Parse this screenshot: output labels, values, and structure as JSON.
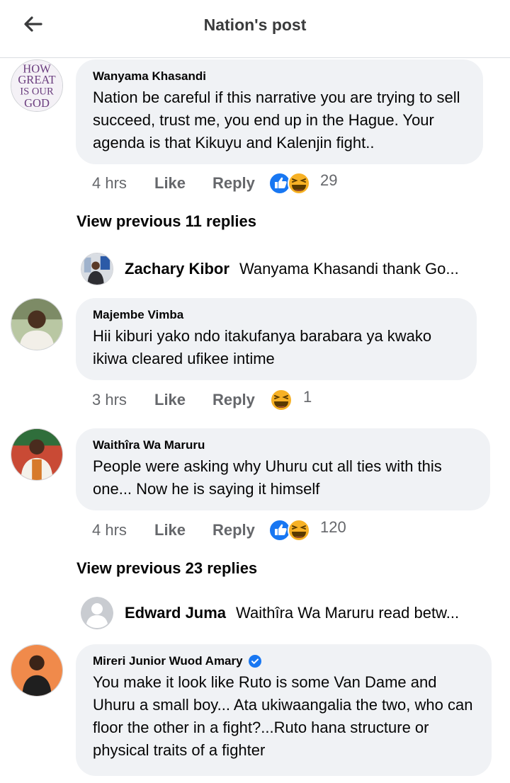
{
  "header": {
    "title": "Nation's post"
  },
  "comments": [
    {
      "author": "Wanyama Khasandi",
      "text": "Nation be careful if this narrative you are trying to sell succeed, trust me, you end up in the Hague. Your agenda is that Kikuyu and Kalenjin fight..",
      "avatar_text": [
        "HOW",
        "GREAT",
        "IS OUR",
        "GOD"
      ],
      "time": "4 hrs",
      "like_label": "Like",
      "reply_label": "Reply",
      "reactions": [
        "like-icon",
        "haha-icon"
      ],
      "reaction_count": "29"
    },
    {
      "author": "Majembe Vimba",
      "text": "Hii kiburi yako ndo itakufanya barabara ya kwako ikiwa cleared ufikee intime",
      "time": "3 hrs",
      "like_label": "Like",
      "reply_label": "Reply",
      "reactions": [
        "haha-icon"
      ],
      "reaction_count": "1"
    },
    {
      "author": "Waithîra Wa Maruru",
      "text": "People were asking why Uhuru cut all ties with this one... Now he is saying it himself",
      "time": "4 hrs",
      "like_label": "Like",
      "reply_label": "Reply",
      "reactions": [
        "like-icon",
        "haha-icon"
      ],
      "reaction_count": "120"
    },
    {
      "author": "Mireri Junior Wuod Amary",
      "verified": true,
      "text": "You make it look like Ruto is some Van Dame and Uhuru a small boy... Ata ukiwaangalia the two, who can floor the other in a fight?...Ruto hana structure or physical traits of a fighter"
    }
  ],
  "view_previous": [
    "View previous 11 replies",
    "View previous 23 replies"
  ],
  "reply_previews": [
    {
      "name": "Zachary Kibor",
      "snippet": "Wanyama Khasandi thank Go..."
    },
    {
      "name": "Edward Juma",
      "snippet": "Waithîra Wa Maruru read betw..."
    }
  ],
  "colors": {
    "like_blue": "#1877f2",
    "haha_yellow": "#f7b125",
    "bubble": "#f0f2f5",
    "meta_gray": "#65676b"
  }
}
